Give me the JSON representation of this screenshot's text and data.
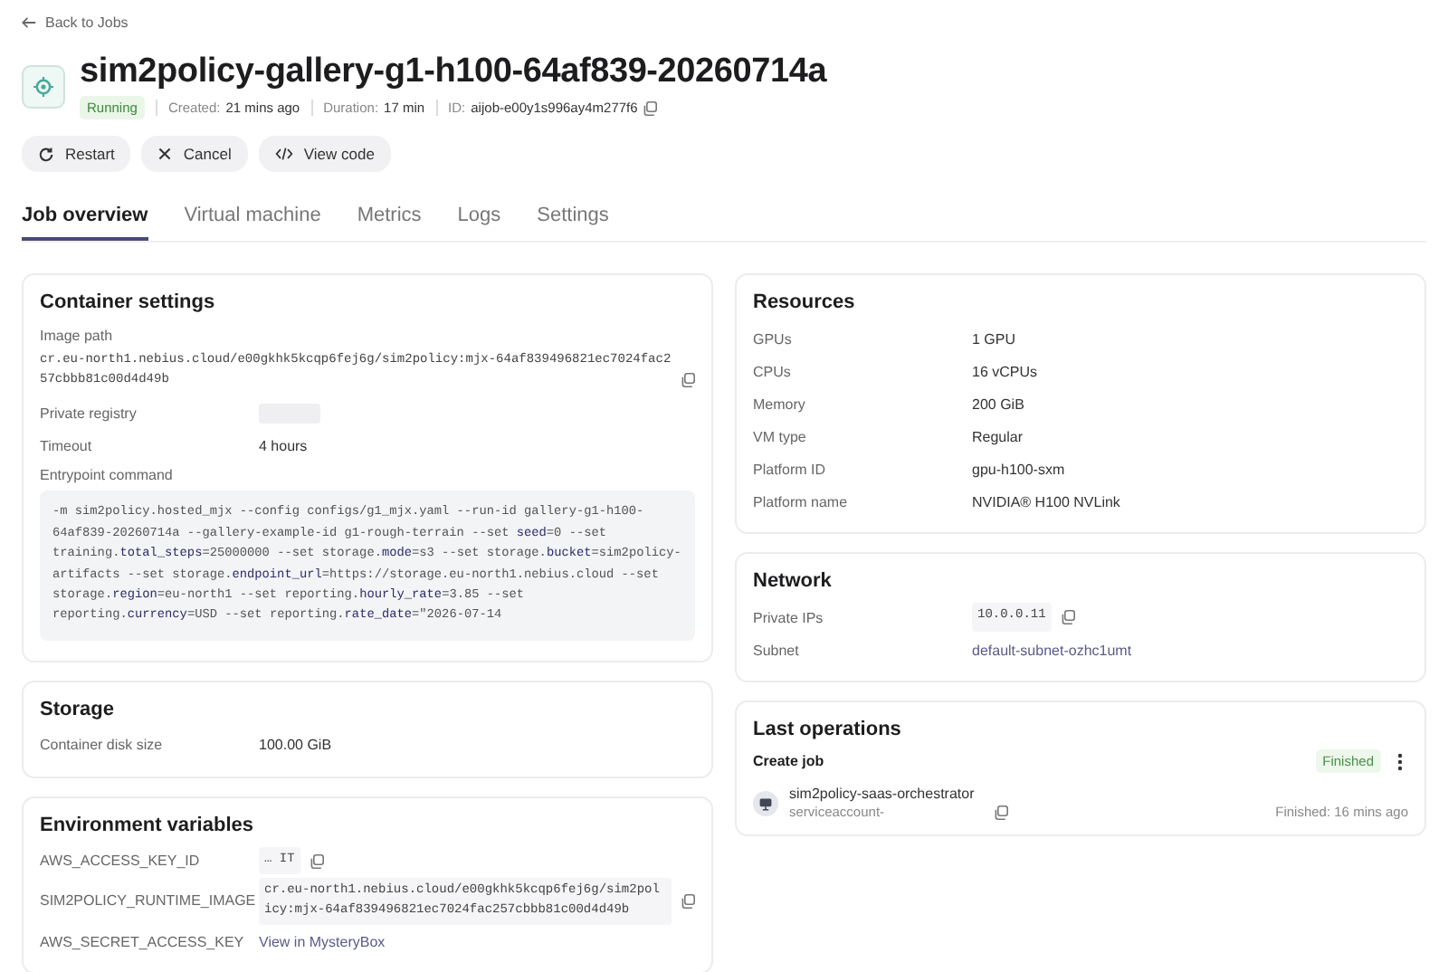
{
  "back_link": "Back to Jobs",
  "job": {
    "title": "sim2policy-gallery-g1-h100-64af839-20260714a",
    "status": "Running",
    "meta": [
      {
        "label": "Created:",
        "value": "21 mins ago",
        "copyable": false
      },
      {
        "label": "Duration:",
        "value": "17 min",
        "copyable": false
      },
      {
        "label": "ID:",
        "value": "aijob-e00y1s996ay4m277f6",
        "copyable": true
      }
    ]
  },
  "actions": [
    {
      "kind": "restart",
      "label": "Restart"
    },
    {
      "kind": "cancel",
      "label": "Cancel"
    },
    {
      "kind": "code",
      "label": "View code"
    }
  ],
  "tabs": [
    {
      "label": "Job overview",
      "selected": true
    },
    {
      "label": "Virtual machine",
      "selected": false
    },
    {
      "label": "Metrics",
      "selected": false
    },
    {
      "label": "Logs",
      "selected": false
    },
    {
      "label": "Settings",
      "selected": false
    }
  ],
  "left_cards": [
    {
      "title": "Container settings",
      "rows": [
        {
          "kind": "path",
          "label": "Image path",
          "value": "cr.eu-north1.nebius.cloud/e00gkhk5kcqp6fej6g/sim2policy:mjx-64af839496821ec7024fac257cbbb81c00d4d49b"
        },
        {
          "kind": "redacted",
          "label": "Private registry"
        },
        {
          "kind": "text",
          "label": "Timeout",
          "value": "4 hours"
        },
        {
          "kind": "command",
          "label": "Entrypoint command",
          "value": "-m sim2policy.hosted_mjx --config configs/g1_mjx.yaml --run-id gallery-g1-h100-64af839-20260714a --gallery-example-id g1-rough-terrain --set **seed**=0 --set training.**total_steps**=25000000 --set storage.**mode**=s3 --set storage.**bucket**=sim2policy-artifacts --set storage.**endpoint_url**=https://storage.eu-north1.nebius.cloud --set storage.**region**=eu-north1 --set reporting.**hourly_rate**=3.85 --set reporting.**currency**=USD --set reporting.**rate_date**=\"2026-07-14"
        }
      ]
    },
    {
      "title": "Storage",
      "rows": [
        {
          "kind": "text",
          "label": "Container disk size",
          "value": "100.00 GiB"
        }
      ]
    },
    {
      "title": "Environment variables",
      "rows": [
        {
          "kind": "mono",
          "label": "AWS_ACCESS_KEY_ID",
          "value": "…  IT"
        },
        {
          "kind": "mono",
          "label": "SIM2POLICY_RUNTIME_IMAGE",
          "value": "cr.eu-north1.nebius.cloud/e00gkhk5kcqp6fej6g/sim2policy:mjx-64af839496821ec7024fac257cbbb81c00d4d49b"
        },
        {
          "kind": "link",
          "label": "AWS_SECRET_ACCESS_KEY",
          "value": "View in MysteryBox"
        }
      ]
    }
  ],
  "right_cards": [
    {
      "title": "Resources",
      "rows": [
        {
          "kind": "text",
          "label": "GPUs",
          "value": "1 GPU"
        },
        {
          "kind": "text",
          "label": "CPUs",
          "value": "16 vCPUs"
        },
        {
          "kind": "text",
          "label": "Memory",
          "value": "200 GiB"
        },
        {
          "kind": "text",
          "label": "VM type",
          "value": "Regular"
        },
        {
          "kind": "text",
          "label": "Platform ID",
          "value": "gpu-h100-sxm"
        },
        {
          "kind": "text",
          "label": "Platform name",
          "value": "NVIDIA® H100 NVLink"
        }
      ]
    },
    {
      "title": "Network",
      "rows": [
        {
          "kind": "mono",
          "label": "Private IPs",
          "value": "10.0.0.11"
        },
        {
          "kind": "link",
          "label": "Subnet",
          "value": "default-subnet-ozhc1umt"
        }
      ]
    }
  ],
  "last_operations": {
    "title": "Last operations",
    "operation": {
      "name": "Create job",
      "status": "Finished",
      "actor": "sim2policy-saas-orchestrator",
      "account": "serviceaccount-",
      "time": "Finished: 16 mins ago"
    }
  }
}
